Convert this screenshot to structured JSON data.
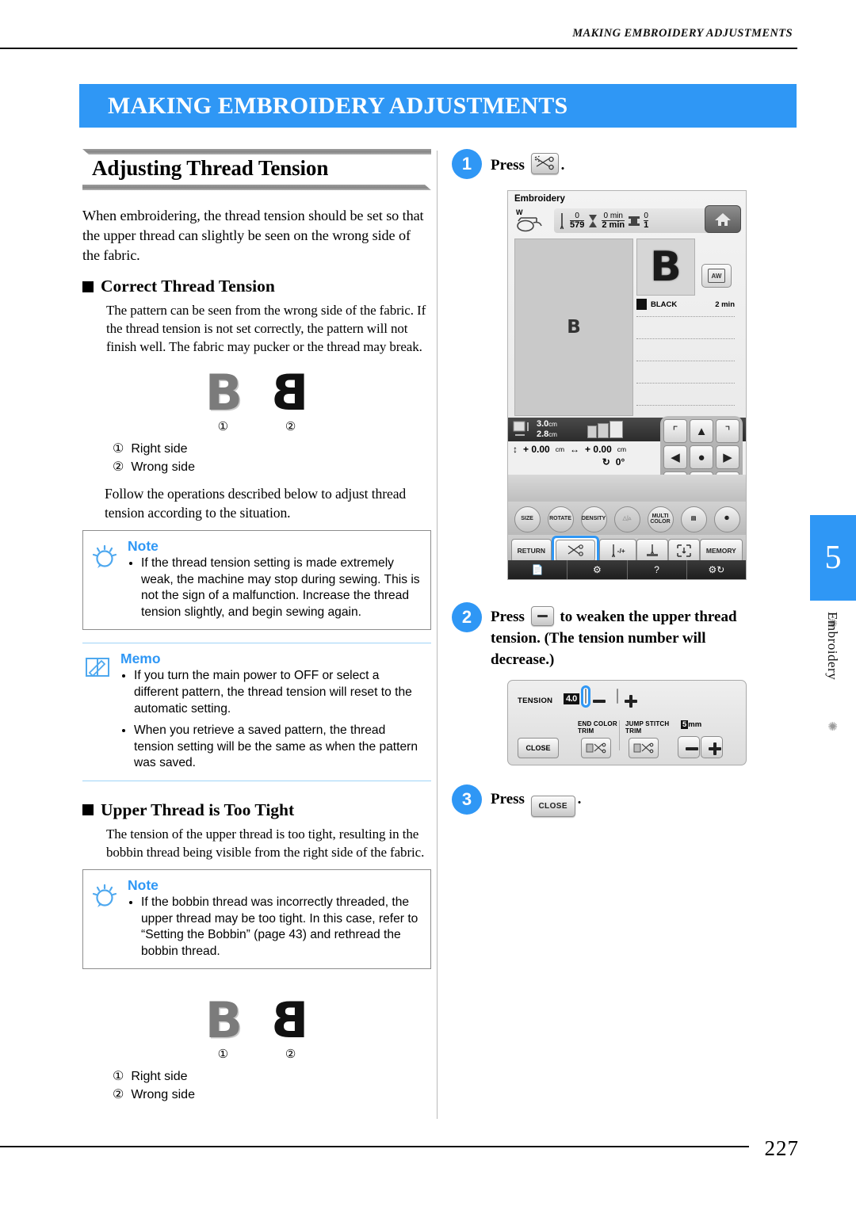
{
  "header": {
    "running_head": "MAKING EMBROIDERY ADJUSTMENTS",
    "chapter_banner": "MAKING EMBROIDERY ADJUSTMENTS"
  },
  "left": {
    "section_title": "Adjusting Thread Tension",
    "intro": "When embroidering, the thread tension should be set so that the upper thread can slightly be seen on the wrong side of the fabric.",
    "sub1": {
      "heading": "Correct Thread Tension",
      "body": "The pattern can be seen from the wrong side of the fabric. If the thread tension is not set correctly, the pattern will not finish well. The fabric may pucker or the thread may break.",
      "figure": {
        "left_glyph": "B",
        "left_num": "①",
        "right_glyph": "B",
        "right_num": "②"
      },
      "legend": [
        {
          "num": "①",
          "text": "Right side"
        },
        {
          "num": "②",
          "text": "Wrong side"
        }
      ],
      "follow": "Follow the operations described below to adjust thread tension according to the situation."
    },
    "note1": {
      "title": "Note",
      "items": [
        "If the thread tension setting is made extremely weak, the machine may stop during sewing. This is not the sign of a malfunction. Increase the thread tension slightly, and begin sewing again."
      ]
    },
    "memo": {
      "title": "Memo",
      "items": [
        "If you turn the main power to OFF or select a different pattern, the thread tension will reset to the automatic setting.",
        "When you retrieve a saved pattern, the thread tension setting will be the same as when the pattern was saved."
      ]
    },
    "sub2": {
      "heading": "Upper Thread is Too Tight",
      "body": "The tension of the upper thread is too tight, resulting in the bobbin thread being visible from the right side of the fabric.",
      "note": {
        "title": "Note",
        "items": [
          "If the bobbin thread was incorrectly threaded, the upper thread may be too tight. In this case, refer to “Setting the Bobbin” (page 43) and rethread the bobbin thread."
        ]
      },
      "figure": {
        "left_glyph": "B",
        "left_num": "①",
        "right_glyph": "B",
        "right_num": "②"
      },
      "legend": [
        {
          "num": "①",
          "text": "Right side"
        },
        {
          "num": "②",
          "text": "Wrong side"
        }
      ]
    }
  },
  "right": {
    "step1": {
      "num": "1",
      "press": "Press",
      "key_icon": "thread-trim-scissors-icon",
      "period": "."
    },
    "step2": {
      "num": "2",
      "press": "Press",
      "key_icon": "minus-icon",
      "text_after": "to weaken the upper thread",
      "line2": "tension. (The tension number will",
      "line3": "decrease.)"
    },
    "step3": {
      "num": "3",
      "press": "Press",
      "key_label": "CLOSE",
      "period": "."
    },
    "lcd": {
      "title": "Embroidery",
      "spool_label": "W",
      "status": {
        "stitch_current": "0",
        "stitch_total": "579",
        "time_current": "0 min",
        "time_total": "2 min",
        "color_current": "0",
        "color_total": "1"
      },
      "home_icon": "home-icon",
      "preview_glyph": "B",
      "mini_glyph": "B",
      "aw_button": "AW",
      "color_name": "BLACK",
      "color_time": "2 min",
      "size_w": "3.0",
      "size_h": "2.8",
      "size_unit": "cm",
      "offset_v": "+ 0.00",
      "offset_h": "+ 0.00",
      "offset_unit": "cm",
      "rotation": "0°",
      "rotate_icon": "rotate-icon",
      "func_buttons": [
        {
          "label": "SIZE",
          "name": "size-button"
        },
        {
          "label": "ROTATE",
          "name": "rotate-button"
        },
        {
          "label": "DENSITY",
          "name": "density-button"
        },
        {
          "label": "",
          "name": "mirror-button"
        },
        {
          "label": "MULTI COLOR",
          "name": "multi-color-button"
        },
        {
          "label": "",
          "name": "bobbin-button"
        },
        {
          "label": "",
          "name": "thread-button"
        }
      ],
      "tool_buttons": [
        {
          "label": "RETURN",
          "name": "return-button"
        },
        {
          "label": "",
          "name": "thread-trim-button"
        },
        {
          "label": "-/+",
          "name": "needle-step-button"
        },
        {
          "label": "",
          "name": "needle-position-button"
        },
        {
          "label": "",
          "name": "trial-button"
        },
        {
          "label": "MEMORY",
          "name": "memory-button"
        }
      ],
      "bottom_bar": [
        {
          "icon": "manual-icon"
        },
        {
          "icon": "machine-setting-icon"
        },
        {
          "icon": "help-icon"
        },
        {
          "icon": "needle-info-icon"
        }
      ]
    },
    "tension_dialog": {
      "tension_label": "TENSION",
      "tension_value": "4.0",
      "minus": "minus-icon",
      "plus": "plus-icon",
      "end_color_trim": "END COLOR TRIM",
      "jump_stitch_trim": "JUMP STITCH TRIM",
      "mm_value": "5",
      "mm_unit": "mm",
      "close_label": "CLOSE"
    }
  },
  "side_tab": {
    "chapter_number": "5",
    "chapter_name": "Embroidery"
  },
  "footer": {
    "page_number": "227"
  },
  "colors": {
    "accent": "#2f97f5",
    "rule": "#111111",
    "box_border": "#8d8d8d"
  }
}
